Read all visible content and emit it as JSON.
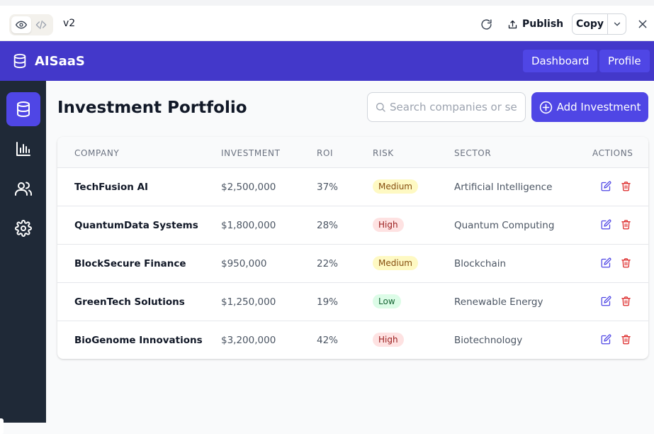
{
  "editor": {
    "version": "v2",
    "publish_label": "Publish",
    "copy_label": "Copy"
  },
  "app": {
    "brand": "AISaaS",
    "nav": {
      "dashboard": "Dashboard",
      "profile": "Profile"
    }
  },
  "sidebar": {
    "items": [
      {
        "icon": "database-icon",
        "active": true
      },
      {
        "icon": "bar-chart-icon",
        "active": false
      },
      {
        "icon": "users-icon",
        "active": false
      },
      {
        "icon": "settings-icon",
        "active": false
      }
    ]
  },
  "main": {
    "title": "Investment Portfolio",
    "search_placeholder": "Search companies or sectors...",
    "add_button": "Add Investment"
  },
  "table": {
    "columns": [
      "Company",
      "Investment",
      "ROI",
      "Risk",
      "Sector",
      "Actions"
    ],
    "rows": [
      {
        "company": "TechFusion AI",
        "investment": "$2,500,000",
        "roi": "37%",
        "risk": "Medium",
        "sector": "Artificial Intelligence"
      },
      {
        "company": "QuantumData Systems",
        "investment": "$1,800,000",
        "roi": "28%",
        "risk": "High",
        "sector": "Quantum Computing"
      },
      {
        "company": "BlockSecure Finance",
        "investment": "$950,000",
        "roi": "22%",
        "risk": "Medium",
        "sector": "Blockchain"
      },
      {
        "company": "GreenTech Solutions",
        "investment": "$1,250,000",
        "roi": "19%",
        "risk": "Low",
        "sector": "Renewable Energy"
      },
      {
        "company": "BioGenome Innovations",
        "investment": "$3,200,000",
        "roi": "42%",
        "risk": "High",
        "sector": "Biotechnology"
      }
    ]
  },
  "colors": {
    "brand": "#4338ca",
    "accent": "#4f46e5",
    "sidebar": "#1f2937",
    "delete": "#dc2626"
  }
}
